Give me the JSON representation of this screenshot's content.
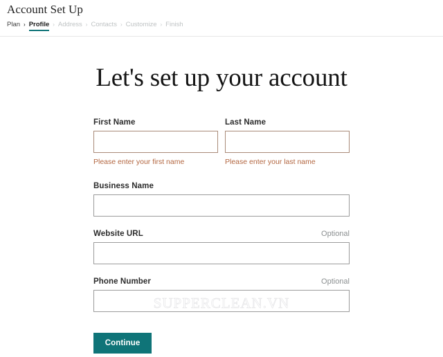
{
  "header": {
    "app_title": "Account Set Up",
    "breadcrumb": {
      "separator": "›",
      "items": [
        {
          "label": "Plan",
          "state": "done"
        },
        {
          "label": "Profile",
          "state": "active"
        },
        {
          "label": "Address",
          "state": "todo"
        },
        {
          "label": "Contacts",
          "state": "todo"
        },
        {
          "label": "Customize",
          "state": "todo"
        },
        {
          "label": "Finish",
          "state": "todo"
        }
      ]
    }
  },
  "main": {
    "page_title": "Let's set up your account",
    "fields": {
      "first_name": {
        "label": "First Name",
        "value": "",
        "placeholder": "",
        "error": "Please enter your first name",
        "optional_label": ""
      },
      "last_name": {
        "label": "Last Name",
        "value": "",
        "placeholder": "",
        "error": "Please enter your last name",
        "optional_label": ""
      },
      "business_name": {
        "label": "Business Name",
        "value": "",
        "placeholder": "",
        "error": "",
        "optional_label": ""
      },
      "website_url": {
        "label": "Website URL",
        "value": "",
        "placeholder": "",
        "error": "",
        "optional_label": "Optional"
      },
      "phone_number": {
        "label": "Phone Number",
        "value": "",
        "placeholder": "",
        "error": "",
        "optional_label": "Optional"
      }
    },
    "continue_button": "Continue"
  },
  "watermark": {
    "text": "SUPPERCLEAN.VN"
  },
  "colors": {
    "accent_teal": "#0f7478",
    "error_text": "#b2653f",
    "error_border": "#a98a78",
    "input_border": "#9b9b9b",
    "optional_gray": "#8b8f90",
    "rule_gray": "#e6e6e6",
    "crumb_todo": "#bfc3c4"
  }
}
